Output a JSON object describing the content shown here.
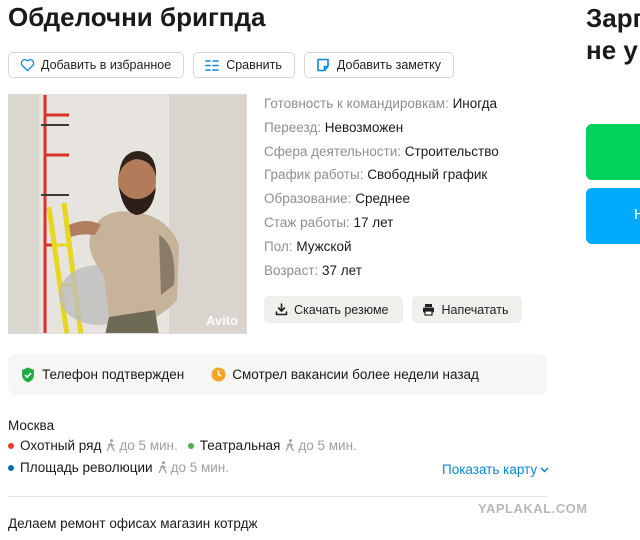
{
  "header": {
    "title": "Обделочни бригпда",
    "right_title_line1": "Зарп",
    "right_title_line2": "не у"
  },
  "actions": [
    {
      "label": "Добавить в избранное",
      "icon": "heart-icon"
    },
    {
      "label": "Сравнить",
      "icon": "compare-icon"
    },
    {
      "label": "Добавить заметку",
      "icon": "note-icon"
    }
  ],
  "photo": {
    "watermark": "Avito"
  },
  "details": [
    {
      "label": "Готовность к командировкам:",
      "value": "Иногда"
    },
    {
      "label": "Переезд:",
      "value": "Невозможен"
    },
    {
      "label": "Сфера деятельности:",
      "value": "Строительство"
    },
    {
      "label": "График работы:",
      "value": "Свободный график"
    },
    {
      "label": "Образование:",
      "value": "Среднее"
    },
    {
      "label": "Стаж работы:",
      "value": "17 лет"
    },
    {
      "label": "Пол:",
      "value": "Мужской"
    },
    {
      "label": "Возраст:",
      "value": "37 лет"
    }
  ],
  "resume_actions": {
    "download": "Скачать резюме",
    "print": "Напечатать"
  },
  "status": {
    "phone": "Телефон подтвержден",
    "activity": "Смотрел вакансии более недели назад"
  },
  "location": {
    "city": "Москва",
    "metro": [
      {
        "name": "Охотный ряд",
        "walk": "до 5 мин.",
        "color": "#e4402f"
      },
      {
        "name": "Театральная",
        "walk": "до 5 мин.",
        "color": "#4fb04f"
      },
      {
        "name": "Площадь революции",
        "walk": "до 5 мин.",
        "color": "#0a6db3"
      }
    ],
    "show_map": "Показать карту"
  },
  "description": "Делаем ремонт офисах магазин котрдж",
  "site_mark": "YAPLAKAL.COM",
  "right_buttons": {
    "blue_label": "Н"
  },
  "colors": {
    "link": "#0a86d8",
    "green": "#02d15c",
    "blue": "#00aaff",
    "shield": "#1fae46",
    "clock": "#f5a623"
  }
}
